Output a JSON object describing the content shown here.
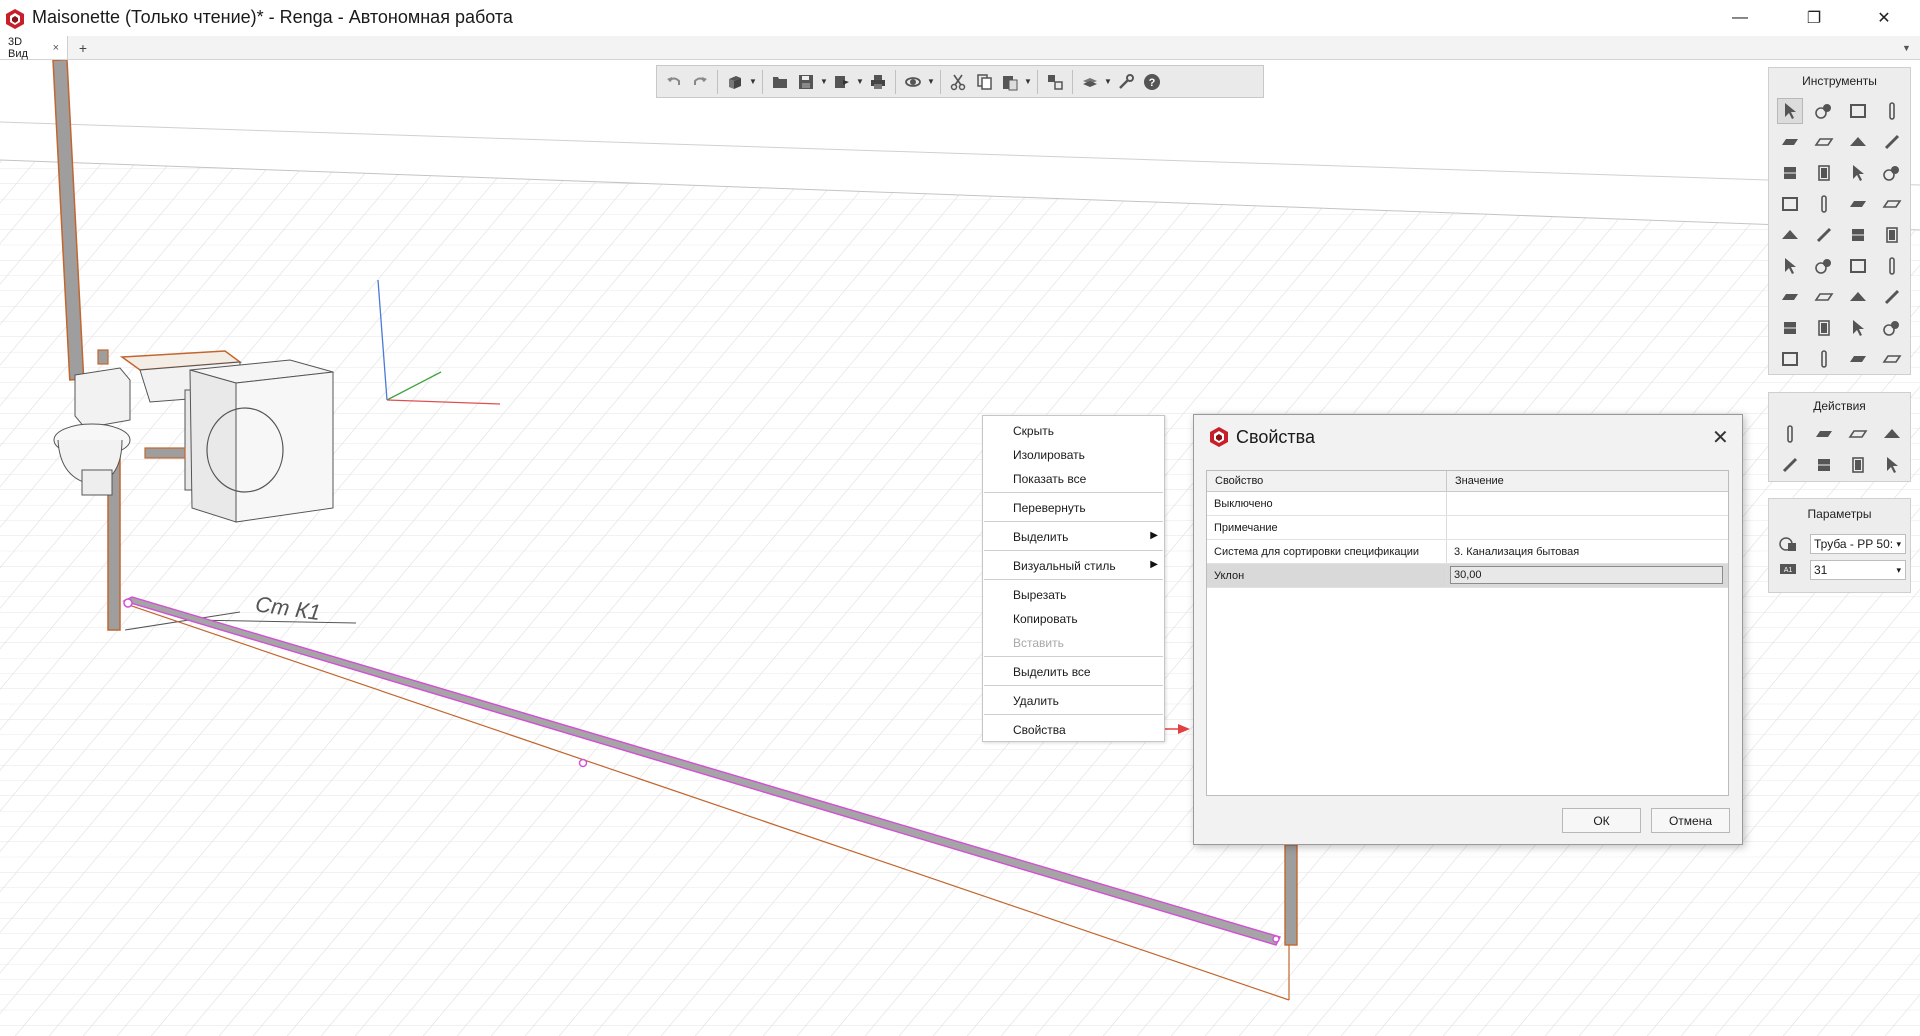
{
  "window": {
    "title": "Maisonette (Только чтение)* - Renga - Автономная работа",
    "minimize": "—",
    "maximize": "❐",
    "close": "✕"
  },
  "tabs": [
    {
      "label": "3D Вид",
      "close": "×"
    }
  ],
  "tab_add": "+",
  "tabbar_menu": "▼",
  "viewport": {
    "annotation": "Ст К1",
    "colors": {
      "pipe": "#9e9e9e",
      "selection": "#d24fd6",
      "guide": "#c2662e",
      "axis_x": "#e05050",
      "axis_y": "#3fa33f",
      "axis_z": "#4a7bd6",
      "grid": "#dcdcdc"
    }
  },
  "toolbar": {
    "items": [
      "undo-icon",
      "redo-icon",
      "3d-view-icon",
      "open-icon",
      "save-icon",
      "export-icon",
      "print-icon",
      "orbit-icon",
      "cut-icon",
      "copy-icon",
      "paste-icon",
      "match-properties-icon",
      "views-icon",
      "settings-icon",
      "help-icon"
    ]
  },
  "panels": {
    "instruments": {
      "title": "Инструменты"
    },
    "actions": {
      "title": "Действия"
    },
    "parameters": {
      "title": "Параметры",
      "pipe_style": "Труба - PP 50:",
      "level": "31",
      "arrow": "▾"
    }
  },
  "context_menu": {
    "items": [
      {
        "label": "Скрыть"
      },
      {
        "label": "Изолировать"
      },
      {
        "label": "Показать все"
      },
      {
        "label": "Перевернуть"
      },
      {
        "label": "Выделить"
      },
      {
        "label": "Визуальный стиль"
      },
      {
        "label": "Вырезать"
      },
      {
        "label": "Копировать"
      },
      {
        "label": "Вставить"
      },
      {
        "label": "Выделить все"
      },
      {
        "label": "Удалить"
      },
      {
        "label": "Свойства"
      }
    ],
    "submenu_arrow": "▶"
  },
  "dialog": {
    "title": "Свойства",
    "close": "✕",
    "columns": [
      "Свойство",
      "Значение"
    ],
    "rows": [
      {
        "name": "Выключено",
        "value": ""
      },
      {
        "name": "Примечание",
        "value": ""
      },
      {
        "name": "Система для сортировки  спецификации",
        "value": "3. Канализация бытовая"
      },
      {
        "name": "Уклон",
        "value": "30,00"
      }
    ],
    "ok": "ОК",
    "cancel": "Отмена"
  }
}
